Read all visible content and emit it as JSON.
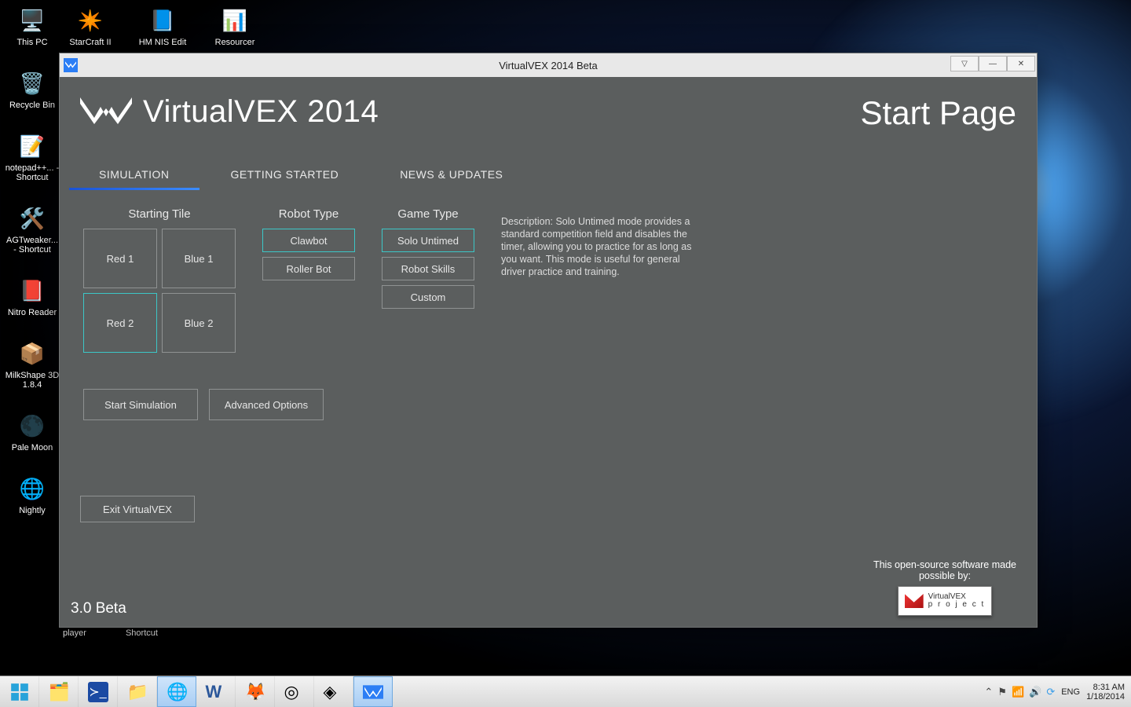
{
  "desktop": {
    "left_icons": [
      {
        "label": "This PC",
        "glyph": "🖥️"
      },
      {
        "label": "Recycle Bin",
        "glyph": "🗑️"
      },
      {
        "label": "notepad++... - Shortcut",
        "glyph": "📝"
      },
      {
        "label": "AGTweaker... - Shortcut",
        "glyph": "🛠️"
      },
      {
        "label": "Nitro Reader",
        "glyph": "📕"
      },
      {
        "label": "MilkShape 3D 1.8.4",
        "glyph": "📦"
      },
      {
        "label": "Pale Moon",
        "glyph": "🌑"
      },
      {
        "label": "Nightly",
        "glyph": "🌐"
      }
    ],
    "top_icons": [
      {
        "label": "StarCraft II",
        "glyph": "✴️"
      },
      {
        "label": "HM NIS Edit",
        "glyph": "📘"
      },
      {
        "label": "Resourcer",
        "glyph": "📊"
      }
    ],
    "below_window": [
      "player",
      "Shortcut"
    ]
  },
  "window": {
    "title": "VirtualVEX 2014 Beta",
    "header": {
      "product": "VirtualVEX 2014",
      "page": "Start Page"
    },
    "tabs": [
      "SIMULATION",
      "GETTING STARTED",
      "NEWS & UPDATES"
    ],
    "selected_tab": 0,
    "columns": {
      "starting_tile": {
        "title": "Starting Tile",
        "tiles": [
          "Red 1",
          "Blue 1",
          "Red 2",
          "Blue 2"
        ],
        "selected": 2
      },
      "robot_type": {
        "title": "Robot Type",
        "options": [
          "Clawbot",
          "Roller Bot"
        ],
        "selected": 0
      },
      "game_type": {
        "title": "Game Type",
        "options": [
          "Solo Untimed",
          "Robot Skills",
          "Custom"
        ],
        "selected": 0
      }
    },
    "description": "Description: Solo Untimed mode provides a standard competition field and disables the timer, allowing you to practice for as long as you want. This mode is useful for general driver practice and training.",
    "actions": {
      "start": "Start Simulation",
      "advanced": "Advanced Options",
      "exit": "Exit VirtualVEX"
    },
    "version": "3.0 Beta",
    "sponsor": {
      "line1": "This open-source software made",
      "line2": "possible by:",
      "brand1": "VirtualVEX",
      "brand2": "p r o j e c t"
    }
  },
  "taskbar": {
    "lang": "ENG",
    "time": "8:31 AM",
    "date": "1/18/2014"
  }
}
